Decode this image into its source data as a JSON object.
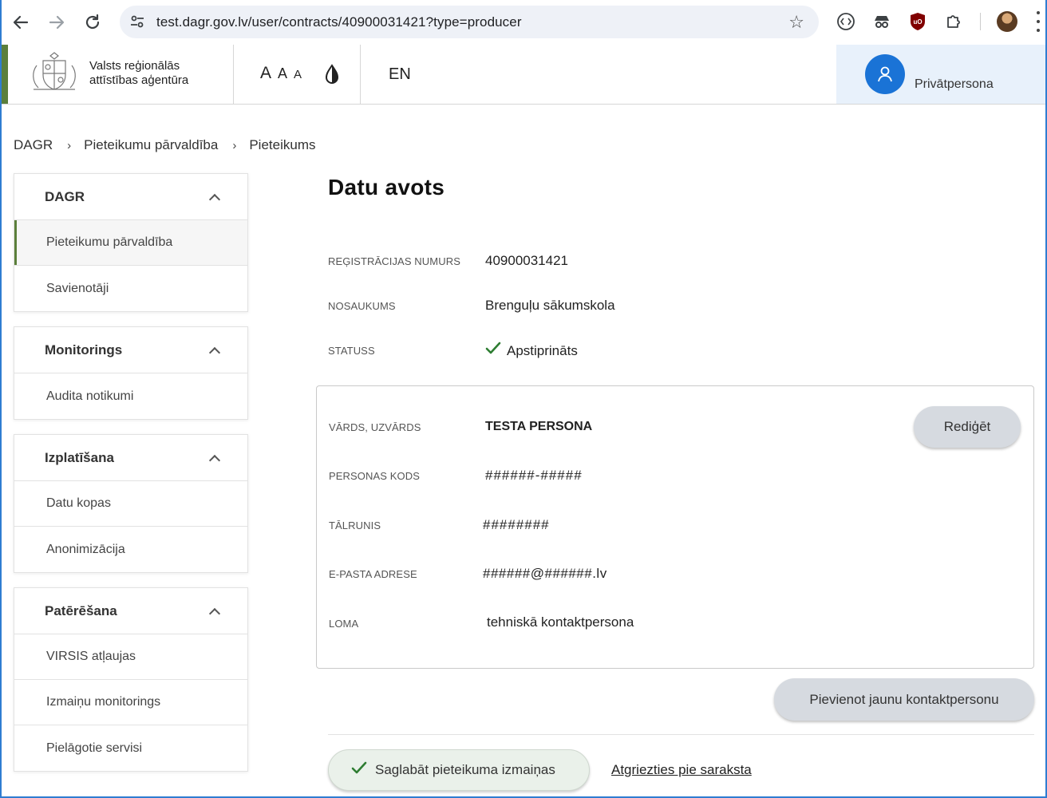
{
  "browser": {
    "url": "test.dagr.gov.lv/user/contracts/40900031421?type=producer"
  },
  "header": {
    "logo_line1": "Valsts reģionālās",
    "logo_line2": "attīstības aģentūra",
    "font_large": "A",
    "font_medium": "A",
    "font_small": "A",
    "language": "EN",
    "user_label": "Privātpersona"
  },
  "breadcrumb": [
    "DAGR",
    "Pieteikumu pārvaldība",
    "Pieteikums"
  ],
  "sidebar": {
    "groups": [
      {
        "title": "DAGR",
        "items": [
          "Pieteikumu pārvaldība",
          "Savienotāji"
        ]
      },
      {
        "title": "Monitorings",
        "items": [
          "Audita notikumi"
        ]
      },
      {
        "title": "Izplatīšana",
        "items": [
          "Datu kopas",
          "Anonimizācija"
        ]
      },
      {
        "title": "Patērēšana",
        "items": [
          "VIRSIS atļaujas",
          "Izmaiņu monitorings",
          "Pielāgotie servisi"
        ]
      }
    ]
  },
  "main": {
    "title": "Datu avots",
    "reg_label": "Reģistrācijas numurs",
    "reg_value": "40900031421",
    "name_label": "Nosaukums",
    "name_value": "Brenguļu sākumskola",
    "status_label": "Statuss",
    "status_value": "Apstiprināts",
    "status_color": "#2e7d32"
  },
  "contact": {
    "person_label": "Vārds, uzvārds",
    "person_value": "TESTA PERSONA",
    "code_label": "Personas kods",
    "code_value": "######-#####",
    "phone_label": "Tālrunis",
    "phone_value": "########",
    "email_label": "E-pasta adrese",
    "email_value": "######@######.lv",
    "role_label": "Loma",
    "role_value": "tehniskā kontaktpersona",
    "edit_button": "Rediģēt"
  },
  "actions": {
    "add_contact": "Pievienot jaunu kontaktpersonu",
    "save": "Saglabāt pieteikuma izmaiņas",
    "back": "Atgriezties pie saraksta"
  }
}
